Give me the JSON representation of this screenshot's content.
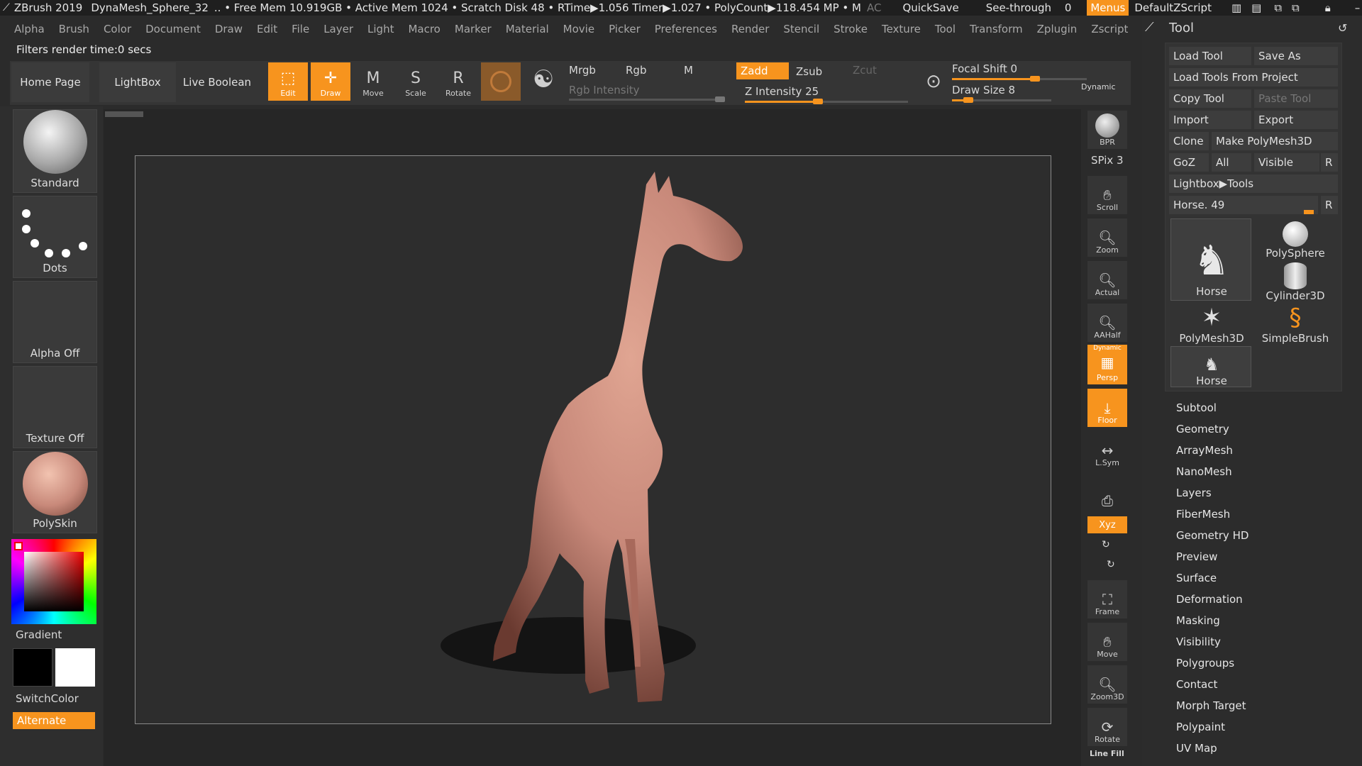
{
  "titlebar": {
    "app": "ZBrush 2019",
    "doc": "DynaMesh_Sphere_32",
    "stats": ".. • Free Mem 10.919GB • Active Mem 1024 • Scratch Disk 48 • RTime▶1.056 Timer▶1.027 • PolyCount▶118.454 MP • M",
    "ac": "AC",
    "quicksave": "QuickSave",
    "seethrough": "See-through",
    "seethrough_value": "0",
    "menus": "Menus",
    "script": "DefaultZScript"
  },
  "menubar": [
    "Alpha",
    "Brush",
    "Color",
    "Document",
    "Draw",
    "Edit",
    "File",
    "Layer",
    "Light",
    "Macro",
    "Marker",
    "Material",
    "Movie",
    "Picker",
    "Preferences",
    "Render",
    "Stencil",
    "Stroke",
    "Texture",
    "Tool",
    "Transform",
    "Zplugin",
    "Zscript"
  ],
  "status": "Filters render time:0 secs",
  "toolbar": {
    "home": "Home Page",
    "lightbox": "LightBox",
    "live_boolean": "Live Boolean",
    "edit": "Edit",
    "draw": "Draw",
    "move": "Move",
    "scale": "Scale",
    "rotate": "Rotate",
    "mrgb": "Mrgb",
    "rgb": "Rgb",
    "m": "M",
    "rgb_intensity": "Rgb Intensity",
    "zadd": "Zadd",
    "zsub": "Zsub",
    "zcut": "Zcut",
    "z_intensity": "Z Intensity 25",
    "z_intensity_value": 25,
    "focal_shift": "Focal Shift 0",
    "focal_shift_value": 0,
    "draw_size": "Draw Size 8",
    "draw_size_value": 8,
    "dynamic": "Dynamic"
  },
  "left": {
    "brush": "Standard",
    "stroke": "Dots",
    "alpha": "Alpha Off",
    "texture": "Texture Off",
    "material": "PolySkin",
    "gradient": "Gradient",
    "switchcolor": "SwitchColor",
    "alternate": "Alternate"
  },
  "rightnav": {
    "bpr": "BPR",
    "spix": "SPix 3",
    "scroll": "Scroll",
    "zoom": "Zoom",
    "actual": "Actual",
    "aahalf": "AAHalf",
    "persp_top": "Dynamic",
    "persp": "Persp",
    "floor": "Floor",
    "lsym": "L.Sym",
    "xyz": "Xyz",
    "frame": "Frame",
    "move": "Move",
    "zoom3d": "Zoom3D",
    "rotate": "Rotate",
    "linefill": "Line Fill"
  },
  "panel": {
    "title": "Tool",
    "load_tool": "Load Tool",
    "save_as": "Save As",
    "load_from_project": "Load Tools From Project",
    "copy_tool": "Copy Tool",
    "paste_tool": "Paste Tool",
    "import": "Import",
    "export": "Export",
    "clone": "Clone",
    "make_polymesh": "Make PolyMesh3D",
    "goz": "GoZ",
    "all": "All",
    "visible": "Visible",
    "r": "R",
    "lightbox_tools": "Lightbox▶Tools",
    "horse_slider": "Horse. 49",
    "thumbs": [
      "Horse",
      "PolySphere",
      "Cylinder3D",
      "PolyMesh3D",
      "SimpleBrush",
      "Horse"
    ],
    "subpalettes": [
      "Subtool",
      "Geometry",
      "ArrayMesh",
      "NanoMesh",
      "Layers",
      "FiberMesh",
      "Geometry HD",
      "Preview",
      "Surface",
      "Deformation",
      "Masking",
      "Visibility",
      "Polygroups",
      "Contact",
      "Morph Target",
      "Polypaint",
      "UV Map"
    ]
  },
  "colors": {
    "accent": "#f7941e",
    "model": "#c8897a",
    "bg": "#2b2b2b"
  }
}
